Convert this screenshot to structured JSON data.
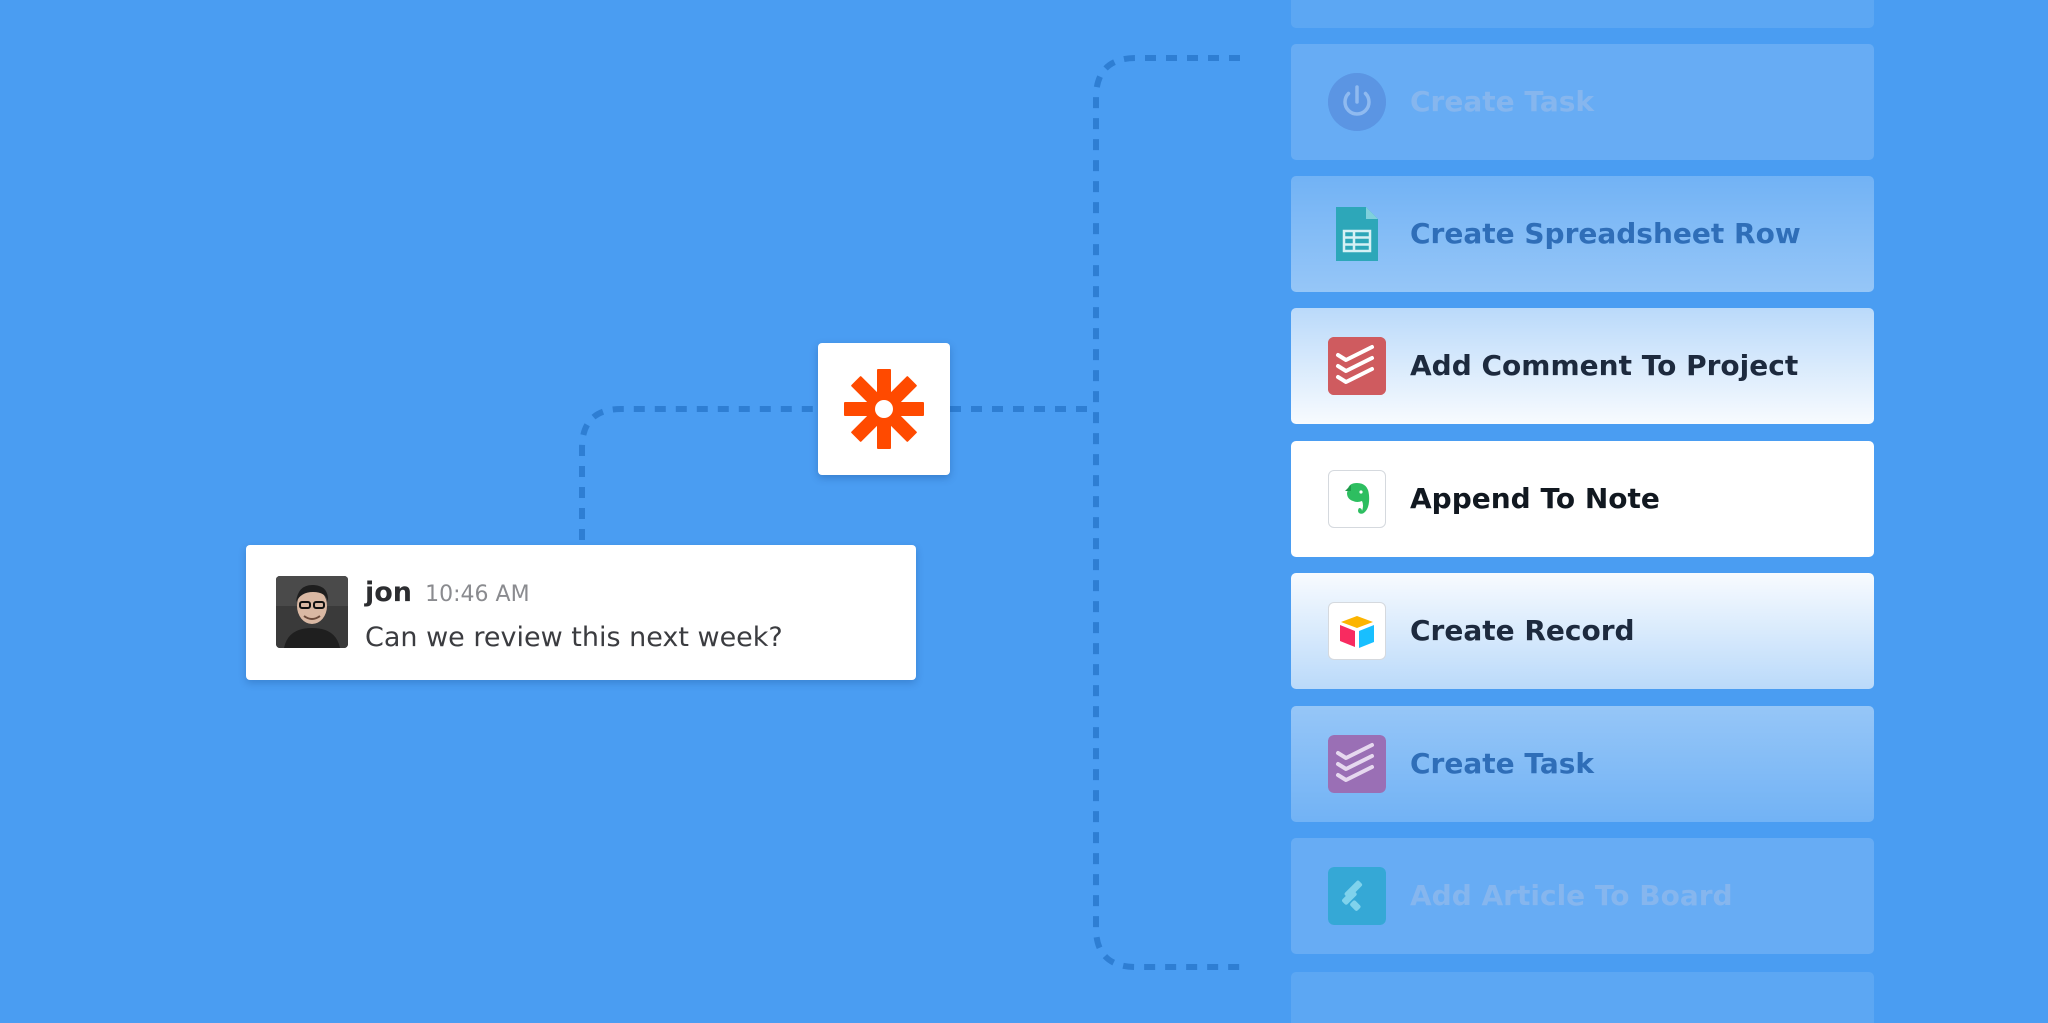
{
  "message": {
    "user": "jon",
    "time": "10:46 AM",
    "text": "Can we review this next week?"
  },
  "actions": [
    {
      "label": "Create Task",
      "icon": "power-icon",
      "state": "faded"
    },
    {
      "label": "Create Spreadsheet Row",
      "icon": "spreadsheet-icon",
      "state": "dim"
    },
    {
      "label": "Add Comment To Project",
      "icon": "todoist-icon",
      "state": "near"
    },
    {
      "label": "Append To Note",
      "icon": "evernote-icon",
      "state": "focused"
    },
    {
      "label": "Create Record",
      "icon": "airtable-icon",
      "state": "near"
    },
    {
      "label": "Create Task",
      "icon": "todoist-icon",
      "state": "dim"
    },
    {
      "label": "Add Article To Board",
      "icon": "feedly-icon",
      "state": "faded"
    }
  ],
  "colors": {
    "background": "#4a9df2",
    "zapier_orange": "#ff4a00",
    "connector": "#2e7ed3"
  }
}
